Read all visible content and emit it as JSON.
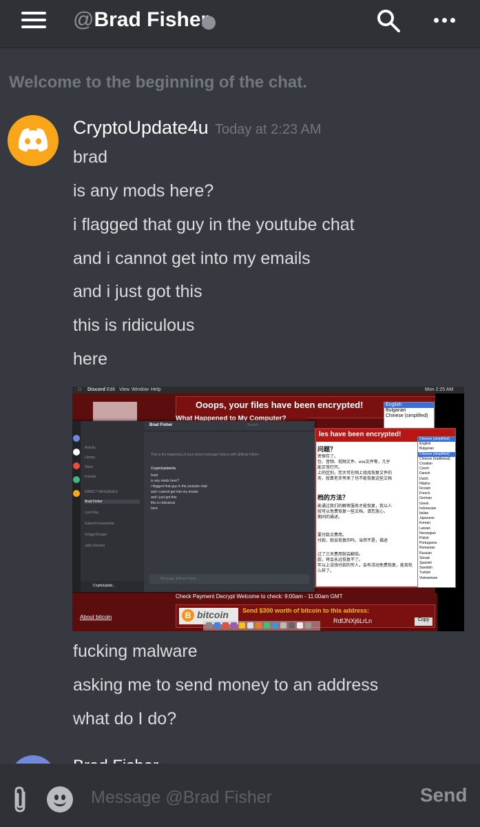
{
  "header": {
    "at_symbol": "@",
    "channel_name": "Brad Fisher",
    "status_color": "#8e9297"
  },
  "welcome_text": "Welcome to the beginning of the chat.",
  "message_group": {
    "author": "CryptoUpdate4u",
    "timestamp": "Today at 2:23 AM",
    "avatar_color": "#faa61a",
    "lines_before": [
      "brad",
      "is any mods here?",
      "i flagged that guy in the youtube chat",
      "and i cannot get into my emails",
      "and i just got this",
      "this is ridiculous",
      "here"
    ],
    "lines_after": [
      "fucking malware",
      "asking me to send money to an address",
      "what do I do?"
    ]
  },
  "attachment": {
    "menu_bar": [
      "Discord",
      "Edit",
      "View",
      "Window",
      "Help"
    ],
    "clock": "Mon 2:25 AM",
    "ransom_title": "Ooops, your files have been encrypted!",
    "ransom_subtitle": "What Happened to My Computer?",
    "language_selected": "English",
    "language_dropdown": [
      "English",
      "Bulgarian",
      "Chinese (simplified)"
    ],
    "inner_discord": {
      "channel": "Brad Fisher",
      "search": "Search",
      "intro": "This is the beginning of your direct message history with @Brad Fisher.",
      "nav": [
        "Activity",
        "Library",
        "Store",
        "Friends"
      ],
      "dm_header": "DIRECT MESSAGES",
      "dms": [
        "Brad Fisher",
        "Lord Ray",
        "Sukuichi Kanamoto",
        "Gregg Morgan",
        "Julia Ghosha"
      ],
      "author": "CryptoUpdate4u",
      "lines": [
        "brad",
        "is any mods here?",
        "i flagged that guy in the youtube chat",
        "and i cannot get into my emails",
        "and i just got this",
        "this is ridiculous",
        "here"
      ],
      "input_placeholder": "Message @Brad Fisher",
      "footer_user": "CryptoUpdat..."
    },
    "ransom_window": {
      "title": "les have been encrypted!",
      "heading1": "问题？",
      "body1": [
        "密保存了。",
        "包、音频、视频文件、exe文件等，几乎",
        "能正常打开。",
        "上的区别，您大可在网上找找恢复文件的",
        "务，就算老天爷来了也不能恢复这些文档"
      ],
      "heading2": "档的方法？",
      "body2": [
        "能通过我们的解密服务才能恢复，我以人",
        "就可以免费恢复一些文档，请您放心，",
        "期间的描述。",
        "要付款点费用。",
        "付款，就会恢复的吗，当然不是，描述",
        "过了三天费用就会翻倍。",
        "款，将会永远恢复不了。",
        "年以上没钱付款的穷人，会有活动免费恢复，能否轮",
        "么样了。"
      ],
      "lang_selected": "Chinese (simplified)",
      "languages": [
        "English",
        "Bulgarian",
        "Chinese (simplified)",
        "Chinese (traditional)",
        "Croatian",
        "Czech",
        "Danish",
        "Dutch",
        "Filipino",
        "Finnish",
        "French",
        "German",
        "Greek",
        "Indonesian",
        "Italian",
        "Japanese",
        "Korean",
        "Latvian",
        "Norwegian",
        "Polish",
        "Portuguese",
        "Romanian",
        "Russian",
        "Slovak",
        "Spanish",
        "Swedish",
        "Turkish",
        "Vietnamese"
      ]
    },
    "check_line": "Check Payment  Decrypt  Welcome to check: 9:00am - 11:00am GMT",
    "about_link": "About bitcoin",
    "bitcoin_logo": "bitcoin",
    "bitcoin_send": "Send $300 worth of bitcoin to this address:",
    "bitcoin_address": "RdfJNXj6LrLn",
    "copy_label": "Copy"
  },
  "next_author": "Brad Fisher",
  "composer": {
    "placeholder": "Message @Brad Fisher",
    "send_label": "Send"
  }
}
